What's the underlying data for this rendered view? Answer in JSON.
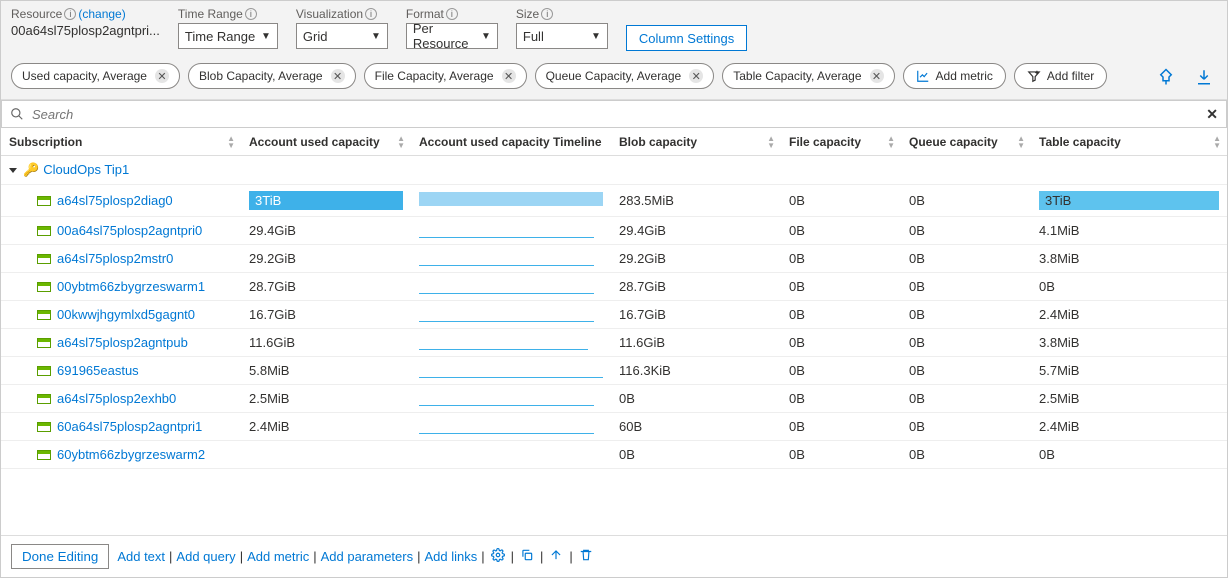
{
  "toolbar": {
    "resourceLabel": "Resource",
    "changeLabel": "(change)",
    "resourceValue": "00a64sl75plosp2agntpri...",
    "timeRangeLabel": "Time Range",
    "timeRangeValue": "Time Range",
    "visualizationLabel": "Visualization",
    "visualizationValue": "Grid",
    "formatLabel": "Format",
    "formatValue": "Per Resource",
    "sizeLabel": "Size",
    "sizeValue": "Full",
    "columnSettings": "Column Settings",
    "addMetric": "Add metric",
    "addFilter": "Add filter",
    "pills": [
      "Used capacity, Average",
      "Blob Capacity, Average",
      "File Capacity, Average",
      "Queue Capacity, Average",
      "Table Capacity, Average"
    ]
  },
  "search": {
    "placeholder": "Search"
  },
  "columns": {
    "c1": "Subscription",
    "c2": "Account used capacity",
    "c3": "Account used capacity Timeline",
    "c4": "Blob capacity",
    "c5": "File capacity",
    "c6": "Queue capacity",
    "c7": "Table capacity"
  },
  "group": {
    "name": "CloudOps Tip1"
  },
  "rows": [
    {
      "name": "a64sl75plosp2diag0",
      "used": "3TiB",
      "usedHighlight": true,
      "timelineFull": true,
      "blob": "283.5MiB",
      "file": "0B",
      "queue": "0B",
      "table": "3TiB",
      "tableHighlight": true
    },
    {
      "name": "00a64sl75plosp2agntpri0",
      "used": "29.4GiB",
      "timelineW": 95,
      "blob": "29.4GiB",
      "file": "0B",
      "queue": "0B",
      "table": "4.1MiB"
    },
    {
      "name": "a64sl75plosp2mstr0",
      "used": "29.2GiB",
      "timelineW": 95,
      "blob": "29.2GiB",
      "file": "0B",
      "queue": "0B",
      "table": "3.8MiB"
    },
    {
      "name": "00ybtm66zbygrzeswarm1",
      "used": "28.7GiB",
      "timelineW": 95,
      "blob": "28.7GiB",
      "file": "0B",
      "queue": "0B",
      "table": "0B"
    },
    {
      "name": "00kwwjhgymlxd5gagnt0",
      "used": "16.7GiB",
      "timelineW": 95,
      "blob": "16.7GiB",
      "file": "0B",
      "queue": "0B",
      "table": "2.4MiB"
    },
    {
      "name": "a64sl75plosp2agntpub",
      "used": "11.6GiB",
      "timelineW": 92,
      "blob": "11.6GiB",
      "file": "0B",
      "queue": "0B",
      "table": "3.8MiB"
    },
    {
      "name": "691965eastus",
      "used": "5.8MiB",
      "timelineW": 100,
      "blob": "116.3KiB",
      "file": "0B",
      "queue": "0B",
      "table": "5.7MiB"
    },
    {
      "name": "a64sl75plosp2exhb0",
      "used": "2.5MiB",
      "timelineW": 95,
      "blob": "0B",
      "file": "0B",
      "queue": "0B",
      "table": "2.5MiB"
    },
    {
      "name": "60a64sl75plosp2agntpri1",
      "used": "2.4MiB",
      "timelineW": 95,
      "blob": "60B",
      "file": "0B",
      "queue": "0B",
      "table": "2.4MiB"
    },
    {
      "name": "60ybtm66zbygrzeswarm2",
      "used": "",
      "timelineW": 0,
      "blob": "0B",
      "file": "0B",
      "queue": "0B",
      "table": "0B"
    }
  ],
  "footer": {
    "doneEditing": "Done Editing",
    "addText": "Add text",
    "addQuery": "Add query",
    "addMetric": "Add metric",
    "addParameters": "Add parameters",
    "addLinks": "Add links"
  }
}
